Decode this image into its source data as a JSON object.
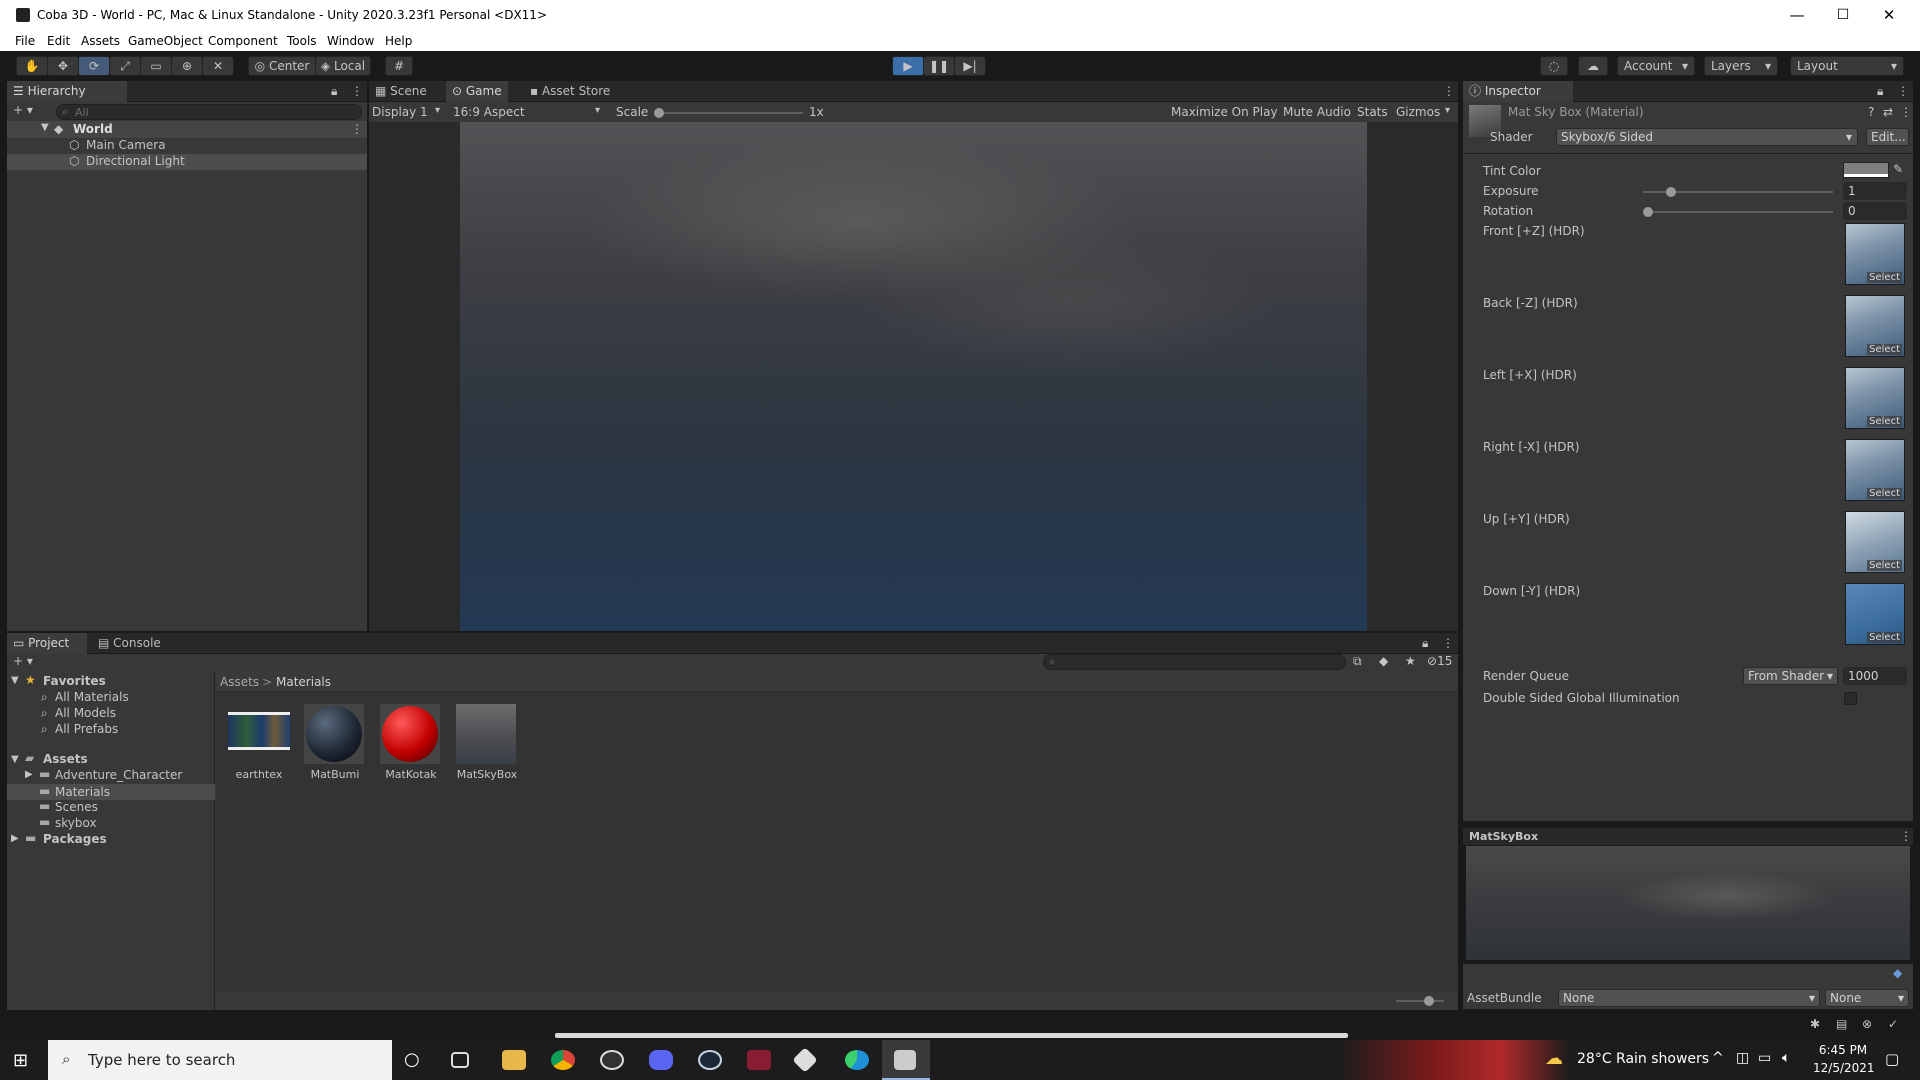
{
  "window": {
    "title": "Coba 3D - World - PC, Mac & Linux Standalone - Unity 2020.3.23f1 Personal <DX11>",
    "minimize": "—",
    "maximize": "☐",
    "close": "✕"
  },
  "menu": [
    "File",
    "Edit",
    "Assets",
    "GameObject",
    "Component",
    "Tools",
    "Window",
    "Help"
  ],
  "toolbar": {
    "center": "Center",
    "local": "Local",
    "account": "Account",
    "layers": "Layers",
    "layout": "Layout",
    "icons": [
      "hand-icon",
      "move-icon",
      "rotate-icon",
      "scale-icon",
      "rect-icon",
      "transform-icon",
      "custom-tool-icon",
      "grid-icon",
      "play-icon",
      "pause-icon",
      "step-icon",
      "collab-icon",
      "cloud-icon"
    ]
  },
  "hierarchy": {
    "tab": "Hierarchy",
    "search_placeholder": "All",
    "scene": "World",
    "items": [
      "Main Camera",
      "Directional Light"
    ]
  },
  "game": {
    "tabs": [
      "Scene",
      "Game",
      "Asset Store"
    ],
    "display": "Display 1",
    "aspect": "16:9 Aspect",
    "scale_label": "Scale",
    "scale_value": "1x",
    "maximize": "Maximize On Play",
    "mute": "Mute Audio",
    "stats": "Stats",
    "gizmos": "Gizmos"
  },
  "inspector": {
    "tab": "Inspector",
    "material_name": "Mat Sky Box (Material)",
    "shader_label": "Shader",
    "shader_value": "Skybox/6 Sided",
    "edit": "Edit...",
    "tint_label": "Tint Color",
    "exposure_label": "Exposure",
    "exposure_value": "1",
    "rotation_label": "Rotation",
    "rotation_value": "0",
    "textures": [
      {
        "label": "Front [+Z]   (HDR)",
        "select": "Select"
      },
      {
        "label": "Back [-Z]   (HDR)",
        "select": "Select"
      },
      {
        "label": "Left [+X]   (HDR)",
        "select": "Select"
      },
      {
        "label": "Right [-X]   (HDR)",
        "select": "Select"
      },
      {
        "label": "Up [+Y]   (HDR)",
        "select": "Select"
      },
      {
        "label": "Down [-Y]   (HDR)",
        "select": "Select"
      }
    ],
    "render_queue_label": "Render Queue",
    "render_queue_mode": "From Shader",
    "render_queue_value": "1000",
    "double_sided_label": "Double Sided Global Illumination",
    "preview_title": "MatSkyBox",
    "assetbundle_label": "AssetBundle",
    "assetbundle_value": "None",
    "assetbundle_variant": "None"
  },
  "project": {
    "tabs": [
      "Project",
      "Console"
    ],
    "hidden_count": "15",
    "favorites_label": "Favorites",
    "favorites": [
      "All Materials",
      "All Models",
      "All Prefabs"
    ],
    "assets_label": "Assets",
    "folders": [
      "Adventure_Character",
      "Materials",
      "Scenes",
      "skybox"
    ],
    "packages_label": "Packages",
    "breadcrumb": [
      "Assets",
      "Materials"
    ],
    "breadcrumb_sep": ">",
    "items": [
      {
        "name": "earthtex"
      },
      {
        "name": "MatBumi"
      },
      {
        "name": "MatKotak"
      },
      {
        "name": "MatSkyBox"
      }
    ]
  },
  "taskbar": {
    "search_placeholder": "Type here to search",
    "weather": "28°C  Rain showers",
    "time": "6:45 PM",
    "date": "12/5/2021",
    "apps": [
      "task-view-icon",
      "file-explorer-icon",
      "chrome-icon",
      "obs-icon",
      "discord-icon",
      "steam-icon",
      "app-red-icon",
      "unity-icon",
      "edge-icon",
      "visual-studio-icon"
    ]
  },
  "colors": {
    "accent": "#465b7a",
    "panel": "#383838",
    "header": "#282828",
    "background": "#191919"
  }
}
